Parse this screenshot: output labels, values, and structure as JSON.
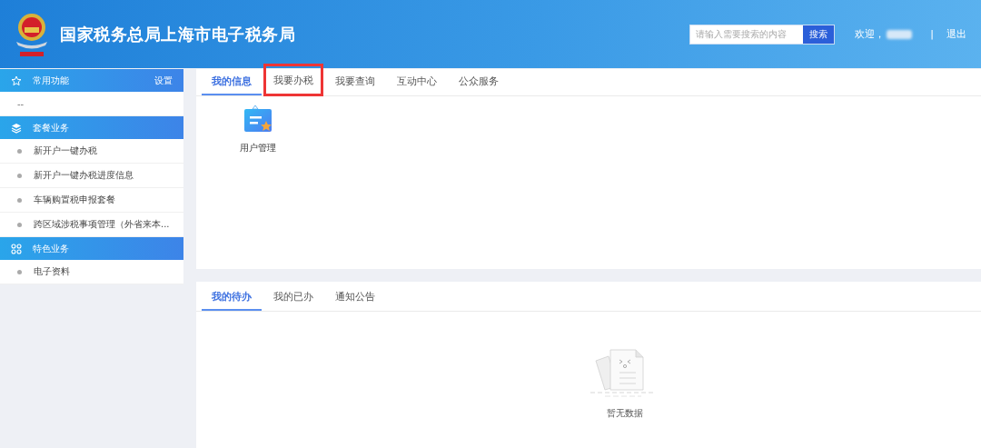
{
  "header": {
    "title": "国家税务总局上海市电子税务局",
    "search": {
      "placeholder": "请输入需要搜索的内容",
      "button": "搜索"
    },
    "welcome": "欢迎，",
    "separator": "|",
    "logout": "退出"
  },
  "sidebar": {
    "sections": [
      {
        "title": "常用功能",
        "kind": "favorites",
        "action": "设置",
        "items": [
          {
            "label": "--",
            "kind": "plain"
          }
        ]
      },
      {
        "title": "套餐业务",
        "kind": "package",
        "items": [
          {
            "label": "新开户一键办税",
            "kind": "bullet"
          },
          {
            "label": "新开户一键办税进度信息",
            "kind": "bullet"
          },
          {
            "label": "车辆购置税申报套餐",
            "kind": "bullet"
          },
          {
            "label": "跨区域涉税事项管理（外省来本...",
            "kind": "bullet"
          }
        ]
      },
      {
        "title": "特色业务",
        "kind": "special",
        "items": [
          {
            "label": "电子资料",
            "kind": "bullet"
          }
        ]
      }
    ]
  },
  "top_panel": {
    "tabs": [
      {
        "label": "我的信息",
        "selected": true,
        "highlighted": false
      },
      {
        "label": "我要办税",
        "selected": false,
        "highlighted": true
      },
      {
        "label": "我要查询",
        "selected": false,
        "highlighted": false
      },
      {
        "label": "互动中心",
        "selected": false,
        "highlighted": false
      },
      {
        "label": "公众服务",
        "selected": false,
        "highlighted": false
      }
    ],
    "tiles": [
      {
        "label": "用户管理"
      }
    ]
  },
  "bottom_panel": {
    "tabs": [
      {
        "label": "我的待办",
        "selected": true
      },
      {
        "label": "我的已办",
        "selected": false
      },
      {
        "label": "通知公告",
        "selected": false
      }
    ],
    "empty_text": "暂无数据"
  }
}
